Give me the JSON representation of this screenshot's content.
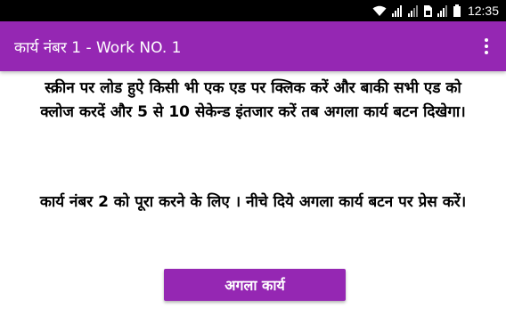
{
  "status_bar": {
    "time": "12:35",
    "icons": [
      "wifi-icon",
      "signal-icon",
      "signal-icon",
      "sim-icon",
      "signal-icon",
      "battery-icon"
    ]
  },
  "app_bar": {
    "title": "कार्य नंबर 1 - Work NO. 1",
    "menu_icon": "overflow-menu-icon",
    "color": "#9527b3"
  },
  "content": {
    "instruction_line1": "स्क्रीन पर लोड हुऐ किसी भी एक एड पर क्लिक करें और बाकी सभी एड को",
    "instruction_line2": "क्लोज करदें और 5 से 10 सेकेन्ड इंतजार करें तब अगला कार्य बटन दिखेगा।",
    "next_task_note": "कार्य नंबर 2 को पूरा करने के लिए । नीचे दिये अगला कार्य बटन पर प्रेस करें।"
  },
  "next_button": {
    "label": "अगला कार्य",
    "color": "#9527b3"
  }
}
